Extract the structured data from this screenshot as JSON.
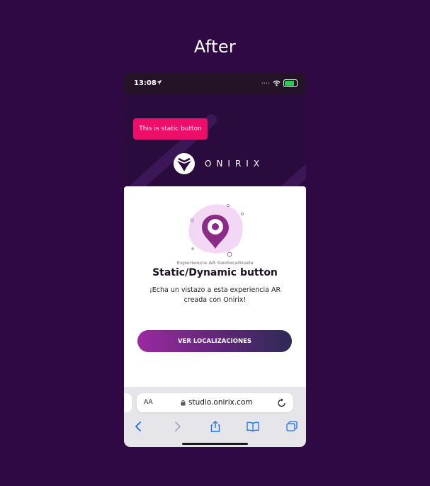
{
  "heading": "After",
  "status": {
    "time": "13:08"
  },
  "static_button": "This is static button",
  "brand": "ONIRIX",
  "card": {
    "subtitle": "Experiencia AR Geolocalizada",
    "title": "Static/Dynamic button",
    "description": "¡Echa un vistazo a esta experiencia AR creada con Onirix!",
    "cta": "VER LOCALIZACIONES"
  },
  "browser": {
    "text_size_label": "AA",
    "url": "studio.onirix.com"
  },
  "colors": {
    "background": "#2e0944",
    "static_button": "#ee0e6a",
    "cta_start": "#9b2aa0",
    "cta_end": "#2d2a55"
  },
  "icons": [
    "location-arrow-icon",
    "wifi-icon",
    "battery-icon",
    "onirix-logo-icon",
    "map-pin-icon",
    "lock-icon",
    "reload-icon",
    "back-icon",
    "forward-icon",
    "share-icon",
    "bookmarks-icon",
    "tabs-icon"
  ]
}
